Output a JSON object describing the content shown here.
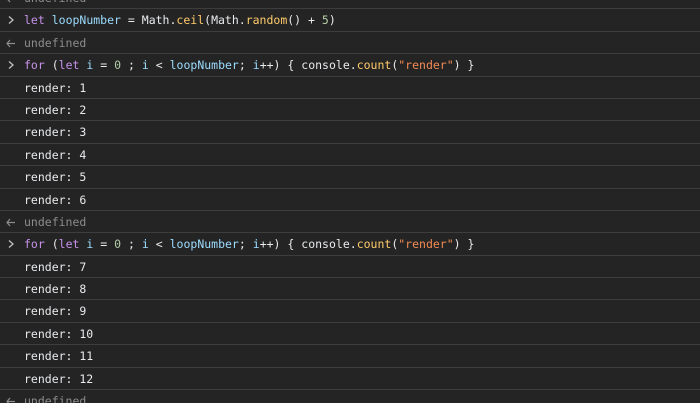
{
  "inputs": [
    "let loopNumber = Math.ceil(Math.random() + 5)",
    "for (let i = 0 ; i < loopNumber; i++) { console.count(\"render\") }",
    "for (let i = 0 ; i < loopNumber; i++) { console.count(\"render\") }"
  ],
  "result_text": "undefined",
  "log_lines_1": [
    "render: 1",
    "render: 2",
    "render: 3",
    "render: 4",
    "render: 5",
    "render: 6"
  ],
  "log_lines_2": [
    "render: 7",
    "render: 8",
    "render: 9",
    "render: 10",
    "render: 11",
    "render: 12"
  ],
  "colors": {
    "background": "#242424",
    "divider": "#3d3d3d",
    "keyword": "#c792ea",
    "variable": "#9cdcfe",
    "method": "#ffcb6b",
    "string": "#f28b54",
    "muted": "#8c8c8c",
    "text": "#e8eaed"
  },
  "icons": {
    "input_prompt": "chevron-right-icon",
    "return_value": "return-arrow-icon"
  }
}
